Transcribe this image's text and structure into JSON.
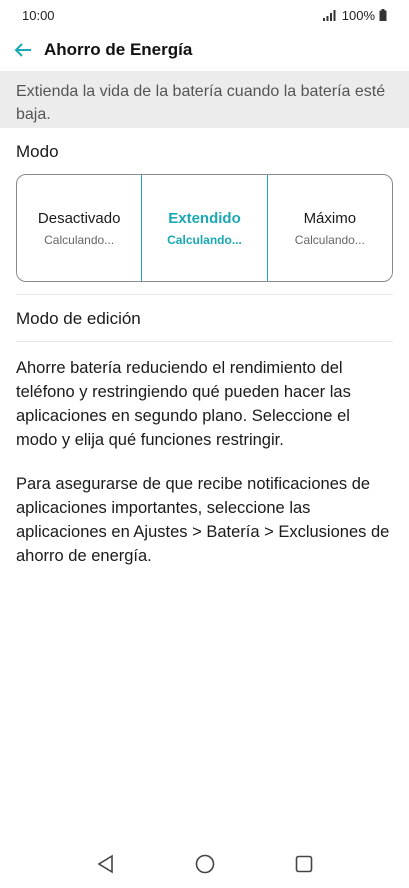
{
  "status": {
    "time": "10:00",
    "battery_text": "100%"
  },
  "app_bar": {
    "title": "Ahorro de Energía",
    "back_icon": "arrow-left-icon"
  },
  "banner": {
    "text": "Extienda la vida de la batería cuando la batería esté baja."
  },
  "mode_section": {
    "label": "Modo",
    "options": [
      {
        "name": "Desactivado",
        "sub": "Calculando...",
        "selected": false
      },
      {
        "name": "Extendido",
        "sub": "Calculando...",
        "selected": true
      },
      {
        "name": "Máximo",
        "sub": "Calculando...",
        "selected": false
      }
    ]
  },
  "edit_mode": {
    "label": "Modo de edición"
  },
  "description": {
    "para1": "Ahorre batería reduciendo el rendimiento del teléfono y restringiendo qué pueden hacer las aplicaciones en segundo plano. Seleccione el modo y elija qué funciones restringir.",
    "para2": "Para asegurarse de que recibe notificaciones de aplicaciones importantes, seleccione las aplicaciones en Ajustes > Batería > Exclusiones de ahorro de energía."
  },
  "colors": {
    "accent": "#1aa9b5",
    "banner_bg": "#ececec"
  }
}
